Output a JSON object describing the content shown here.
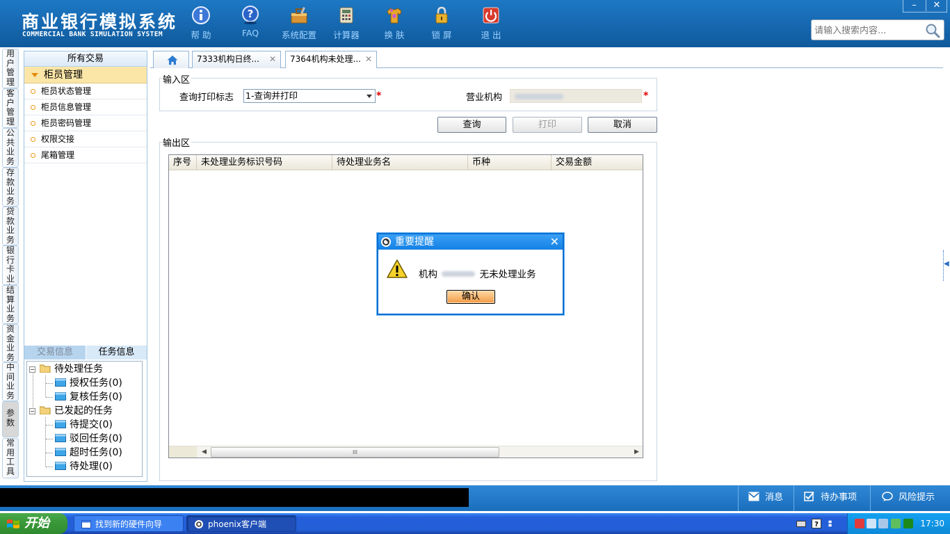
{
  "header": {
    "title": "商业银行模拟系统",
    "subtitle": "COMMERCIAL BANK SIMULATION SYSTEM",
    "tools": [
      {
        "label": "帮 助",
        "icon": "info-icon"
      },
      {
        "label": "FAQ",
        "icon": "question-icon"
      },
      {
        "label": "系统配置",
        "icon": "toolbox-icon"
      },
      {
        "label": "计算器",
        "icon": "calculator-icon"
      },
      {
        "label": "换 肤",
        "icon": "shirt-icon"
      },
      {
        "label": "锁 屏",
        "icon": "lock-icon"
      },
      {
        "label": "退 出",
        "icon": "power-icon"
      }
    ],
    "search_placeholder": "请输入搜索内容...",
    "minimize": "–",
    "close": "✕"
  },
  "vtabs": [
    "用户管理",
    "客户管理",
    "公共业务",
    "存款业务",
    "贷款业务",
    "银行卡业务",
    "结算业务",
    "资金业务",
    "中间业务",
    "参数",
    "常用工具"
  ],
  "leftpanel": {
    "header": "所有交易",
    "group": "柜员管理",
    "items": [
      "柜员状态管理",
      "柜员信息管理",
      "柜员密码管理",
      "权限交接",
      "尾箱管理"
    ],
    "tab_trade": "交易信息",
    "tab_task": "任务信息",
    "tree": {
      "pending": "待处理任务",
      "auth": "授权任务(0)",
      "review": "复核任务(0)",
      "initiated": "已发起的任务",
      "submit": "待提交(0)",
      "rejected": "驳回任务(0)",
      "timeout": "超时任务(0)",
      "processing": "待处理(0)"
    }
  },
  "tabs": [
    {
      "label": "7333机构日终..."
    },
    {
      "label": "7364机构未处理..."
    }
  ],
  "form": {
    "input_legend": "输入区",
    "print_flag_label": "查询打印标志",
    "print_flag_value": "1-查询并打印",
    "org_label": "营业机构",
    "required": "*",
    "query": "查询",
    "print": "打印",
    "cancel": "取消",
    "output_legend": "输出区",
    "columns": [
      "序号",
      "未处理业务标识号码",
      "待处理业务名",
      "币种",
      "交易金额"
    ],
    "scroll_grip": "III"
  },
  "dialog": {
    "title": "重要提醒",
    "msg_prefix": "机构",
    "msg_suffix": "无未处理业务",
    "ok": "确认",
    "close": "✕"
  },
  "statusbar": {
    "messages": "消息",
    "todo": "待办事项",
    "risk": "风险提示"
  },
  "taskbar": {
    "start": "开始",
    "task1": "找到新的硬件向导",
    "task2": "phoenix客户端",
    "time": "17:30"
  },
  "colors": {
    "header_blue": "#1566ad",
    "dialog_title": "#1481e5",
    "ok_button": "#f29a45",
    "required": "#dd0000"
  }
}
